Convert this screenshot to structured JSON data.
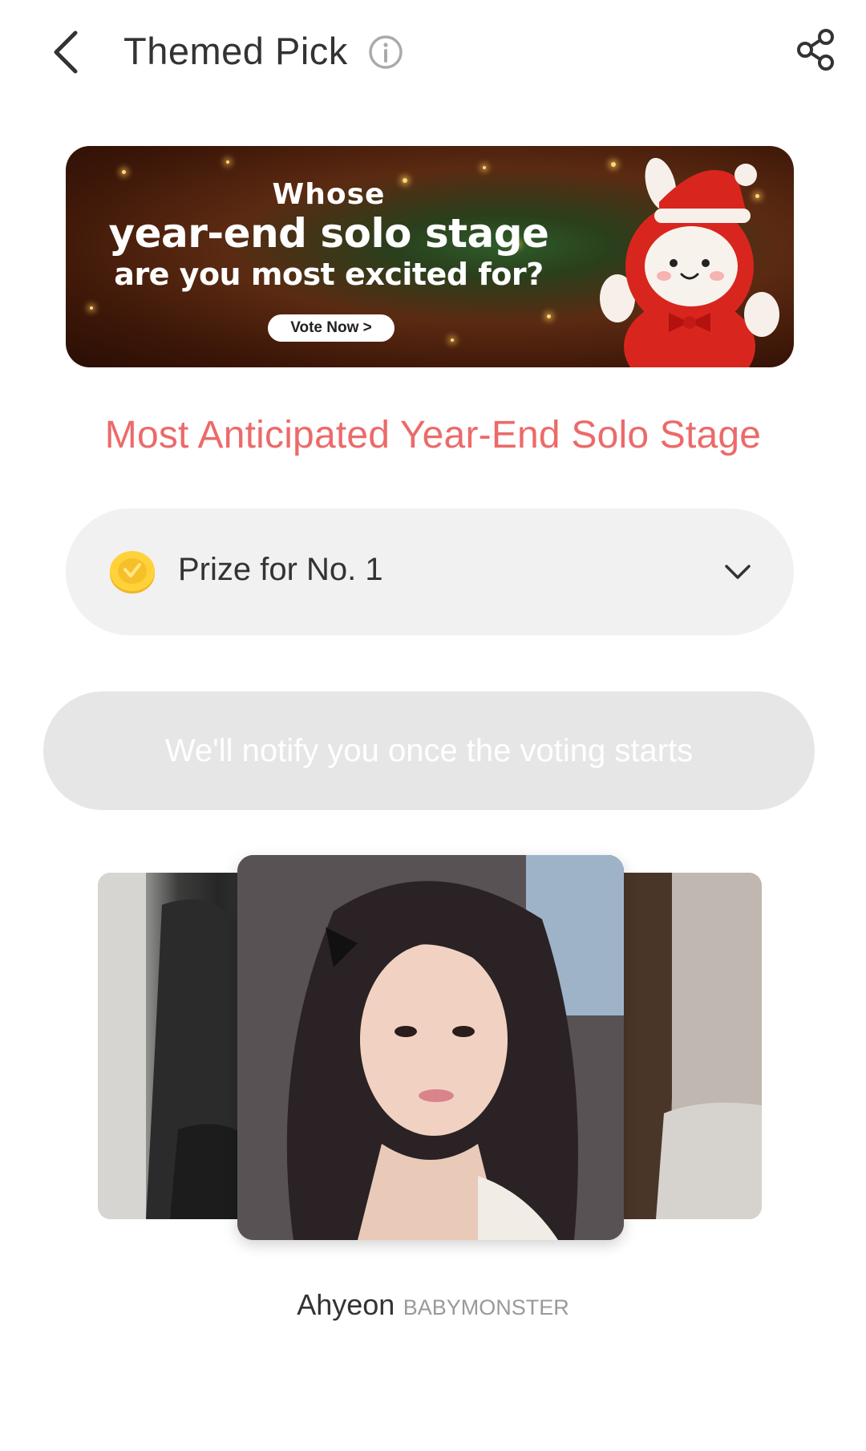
{
  "header": {
    "title": "Themed Pick",
    "back_icon": "chevron-left-icon",
    "info_icon": "info-icon",
    "share_icon": "share-icon"
  },
  "banner": {
    "line1": "Whose",
    "line2": "year-end solo stage",
    "line3": "are you most excited for?",
    "button": "Vote Now >"
  },
  "section_title": "Most Anticipated Year-End Solo Stage",
  "prize": {
    "label": "Prize for No. 1",
    "icon": "coin-icon",
    "expand_icon": "chevron-down-icon"
  },
  "notify": {
    "label": "We'll notify you once the voting starts"
  },
  "carousel": {
    "current": {
      "name": "Ahyeon",
      "group": "BABYMONSTER"
    }
  },
  "colors": {
    "accent": "#ec6a6a",
    "pill_bg": "#f1f1f1",
    "notify_bg": "#e6e6e6"
  }
}
